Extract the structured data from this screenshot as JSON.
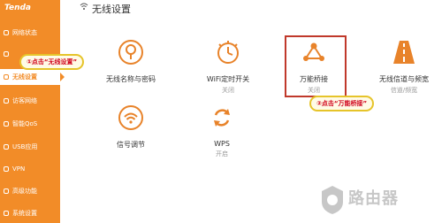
{
  "brand": {
    "logo_text": "Tenda"
  },
  "page": {
    "title": "无线设置"
  },
  "sidebar": {
    "items": [
      {
        "label": "网络状态"
      },
      {
        "label": ""
      },
      {
        "label": "无线设置",
        "active": true
      },
      {
        "label": "访客网络"
      },
      {
        "label": "智能QoS"
      },
      {
        "label": "USB应用"
      },
      {
        "label": "VPN"
      },
      {
        "label": "高级功能"
      },
      {
        "label": "系统设置"
      }
    ]
  },
  "tiles": [
    {
      "label": "无线名称与密码",
      "status": "",
      "icon": "wifi-name-password-icon"
    },
    {
      "label": "WiFi定时开关",
      "status": "关闭",
      "icon": "wifi-timer-icon"
    },
    {
      "label": "万能桥接",
      "status": "关闭",
      "icon": "universal-bridge-icon"
    },
    {
      "label": "无线信道与频宽",
      "status": "信道/频宽",
      "icon": "channel-bandwidth-icon"
    },
    {
      "label": "信号调节",
      "status": "",
      "icon": "signal-adjust-icon"
    },
    {
      "label": "WPS",
      "status": "开启",
      "icon": "wps-icon"
    }
  ],
  "annotations": {
    "step1": "①点击“无线设置”",
    "step2": "②点击“万能桥接”"
  },
  "watermark": {
    "text": "路由器"
  },
  "colors": {
    "sidebar": "#f28c28",
    "icon": "#e8832a",
    "callout_text": "#d0021b",
    "highlight": "#c0392b"
  }
}
